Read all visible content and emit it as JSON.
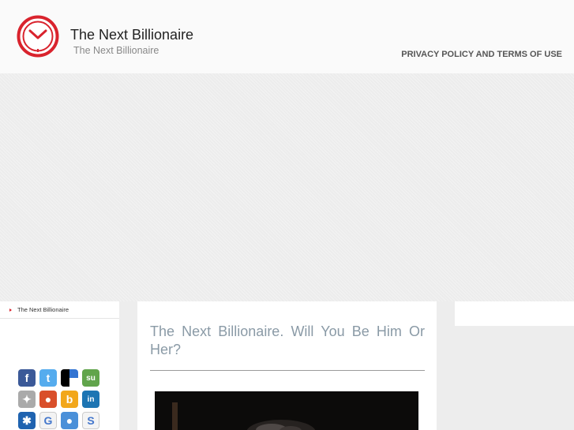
{
  "header": {
    "site_title": "The Next Billionaire",
    "tagline": "The Next Billionaire",
    "nav_link": "PRIVACY POLICY AND TERMS OF USE",
    "logo_icon": "clock-icon"
  },
  "sidebar": {
    "link": "The Next Billionaire",
    "social_icons": [
      {
        "name": "facebook-icon",
        "glyph": "f",
        "color": "#3b5998"
      },
      {
        "name": "twitter-icon",
        "glyph": "t",
        "color": "#55acee"
      },
      {
        "name": "delicious-icon",
        "glyph": "",
        "color": "#000000"
      },
      {
        "name": "stumbleupon-icon",
        "glyph": "su",
        "color": "#61a44b"
      },
      {
        "name": "myspace-icon",
        "glyph": "✦",
        "color": "#aaaaaa"
      },
      {
        "name": "orkut-icon",
        "glyph": "●",
        "color": "#d94f2b"
      },
      {
        "name": "buzz-icon",
        "glyph": "b",
        "color": "#f2a71b"
      },
      {
        "name": "linkedin-icon",
        "glyph": "in",
        "color": "#1d75b3"
      },
      {
        "name": "messenger-icon",
        "glyph": "✱",
        "color": "#1f63b0"
      },
      {
        "name": "google-icon",
        "glyph": "G",
        "color": "#f3f3f3"
      },
      {
        "name": "netvibes-icon",
        "glyph": "●",
        "color": "#4a90d9"
      },
      {
        "name": "slashdot-icon",
        "glyph": "S",
        "color": "#f4f4f4"
      }
    ]
  },
  "post": {
    "title": "The Next Billionaire. Will You Be Him Or Her?"
  },
  "colors": {
    "accent": "#d9232d",
    "title": "#8a9aa6"
  }
}
